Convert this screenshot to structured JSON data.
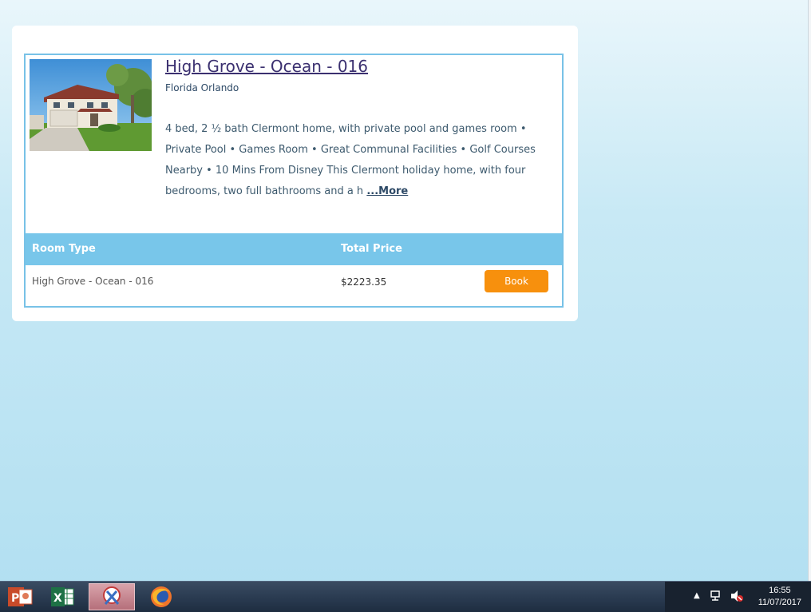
{
  "listing": {
    "title": "High Grove - Ocean - 016",
    "location": "Florida Orlando",
    "description": "4 bed, 2 ½ bath Clermont home, with private pool and games room • Private Pool • Games Room • Great Communal Facilities • Golf Courses Nearby • 10 Mins From Disney This Clermont holiday home, with four bedrooms, two full bathrooms and a h",
    "more_label": "...More"
  },
  "table": {
    "headers": [
      "Room Type",
      "Total Price"
    ],
    "rows": [
      {
        "room_type": "High Grove - Ocean - 016",
        "total_price": "$2223.35",
        "action_label": "Book"
      }
    ]
  },
  "taskbar": {
    "apps": [
      {
        "name": "powerpoint",
        "icon": "powerpoint-icon"
      },
      {
        "name": "excel",
        "icon": "excel-icon"
      },
      {
        "name": "snipping-tool",
        "icon": "snipping-tool-icon",
        "active": true
      },
      {
        "name": "firefox",
        "icon": "firefox-icon"
      }
    ],
    "time": "16:55",
    "date": "11/07/2017"
  },
  "colors": {
    "accent_border": "#78c2e7",
    "table_header_bg": "#78c6ea",
    "book_button": "#f7900d",
    "title_link": "#3b3070"
  }
}
